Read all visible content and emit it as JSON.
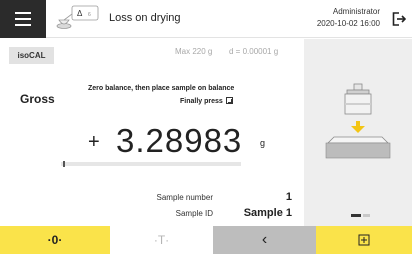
{
  "header": {
    "title": "Loss on drying",
    "user": "Administrator",
    "datetime": "2020-10-02   16:00",
    "app_icon_label": "Δ"
  },
  "main": {
    "isocal_label": "isoCAL",
    "capacity": "Max 220 g",
    "readability": "d = 0.00001 g",
    "mode": "Gross",
    "instruction_line1": "Zero balance, then place sample on balance",
    "instruction_line2": "Finally press",
    "sign": "+",
    "weight_value": "3.28983",
    "unit": "g",
    "weighing_range_fraction": 0.01,
    "sample_number_label": "Sample number",
    "sample_number_value": "1",
    "sample_id_label": "Sample ID",
    "sample_id_value": "Sample 1"
  },
  "side": {
    "pages": 2,
    "active_page": 1
  },
  "toolbar": {
    "zero_label": "·0·",
    "tare_label": "·T·",
    "back_label": "‹"
  },
  "colors": {
    "accent": "#fae34a",
    "menu_bg": "#2b2b2b",
    "side_bg": "#eeeeee",
    "back_bg": "#bdbdbd",
    "arrow": "#f3c514"
  },
  "icons": {
    "menu": "hamburger-icon",
    "app": "balance-delta-icon",
    "logout": "logout-icon",
    "instruction": "print-key-icon",
    "illustration": "weight-on-pan-illustration",
    "print": "print-key-icon"
  }
}
